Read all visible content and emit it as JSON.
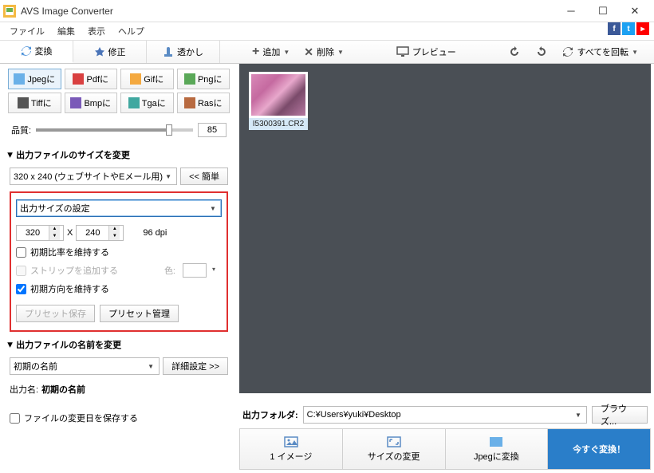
{
  "window": {
    "title": "AVS Image Converter"
  },
  "menu": {
    "file": "ファイル",
    "edit": "編集",
    "view": "表示",
    "help": "ヘルプ"
  },
  "tabs": {
    "convert": "変換",
    "retouch": "修正",
    "watermark": "透かし"
  },
  "toolbar": {
    "add": "追加",
    "delete": "削除",
    "preview": "プレビュー",
    "rotate_all": "すべてを回転"
  },
  "formats": {
    "jpeg": "Jpegに",
    "pdf": "Pdfに",
    "gif": "Gifに",
    "png": "Pngに",
    "tiff": "Tiffに",
    "bmp": "Bmpに",
    "tga": "Tgaに",
    "ras": "Rasに"
  },
  "quality": {
    "label": "品質:",
    "value": "85"
  },
  "resize": {
    "header": "出力ファイルのサイズを変更",
    "preset": "320 x 240 (ウェブサイトやEメール用)",
    "simple_btn": "<< 簡単",
    "settings_label": "出力サイズの設定",
    "width": "320",
    "x": "X",
    "height": "240",
    "dpi": "96 dpi",
    "keep_ratio": "初期比率を維持する",
    "add_strip": "ストリップを追加する",
    "color_label": "色:",
    "keep_orientation": "初期方向を維持する",
    "save_preset": "プリセット保存",
    "manage_preset": "プリセット管理"
  },
  "rename": {
    "header": "出力ファイルの名前を変更",
    "preset": "初期の名前",
    "adv_btn": "詳細設定 >>",
    "output_label": "出力名:",
    "output_value": "初期の名前"
  },
  "preserve_date": "ファイルの変更日を保存する",
  "thumbnail": {
    "name": "I5300391.CR2"
  },
  "output": {
    "label": "出力フォルダ:",
    "path": "C:¥Users¥yuki¥Desktop",
    "browse": "ブラウズ..."
  },
  "actions": {
    "images": "1 イメージ",
    "resize": "サイズの変更",
    "to_jpeg": "Jpegに変換",
    "convert_now": "今すぐ変換！"
  }
}
